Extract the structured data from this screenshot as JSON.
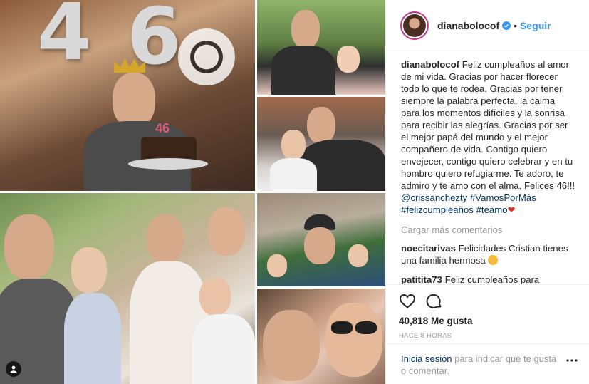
{
  "post": {
    "username": "dianabolocof",
    "follow_label": "Seguir",
    "dot": "•"
  },
  "collage": {
    "balloon_digits": [
      "4",
      "6"
    ],
    "candle_digits": "46"
  },
  "caption": {
    "author": "dianabolocof",
    "text": "Feliz cumpleaños al amor de mi vida. Gracias por hacer florecer todo lo que te rodea. Gracias por tener siempre la palabra perfecta, la calma para los momentos difíciles y la sonrisa para recibir las alegrías. Gracias por ser el mejor papá del mundo y el mejor compañero de vida. Contigo quiero envejecer, contigo quiero celebrar y en tu hombro quiero refugiarme. Te adoro, te admiro y te amo con el alma. Felices 46!!! ",
    "mention": "@crissanchezty",
    "hashtags": [
      "#VamosPorMás",
      "#felizcumpleaños",
      "#teamo"
    ],
    "heart": "❤"
  },
  "load_more_label": "Cargar más comentarios",
  "comments": [
    {
      "user": "noecitarivas",
      "text": "Felicidades Cristian tienes una familia hermosa"
    },
    {
      "user": "patitita73",
      "text": "Feliz cumpleaños para Cristian, muchas felicidades a toda tu hermosa familia"
    }
  ],
  "likes": "40,818 Me gusta",
  "time_ago": "HACE 8 HORAS",
  "login": {
    "link": "Inicia sesión",
    "rest": " para indicar que te gusta o comentar."
  },
  "colors": {
    "accent": "#3897f0",
    "link": "#003569",
    "muted": "#999999",
    "border": "#efefef"
  },
  "icons": [
    "verified-icon",
    "heart-icon",
    "comment-icon",
    "more-icon",
    "user-badge-icon"
  ]
}
